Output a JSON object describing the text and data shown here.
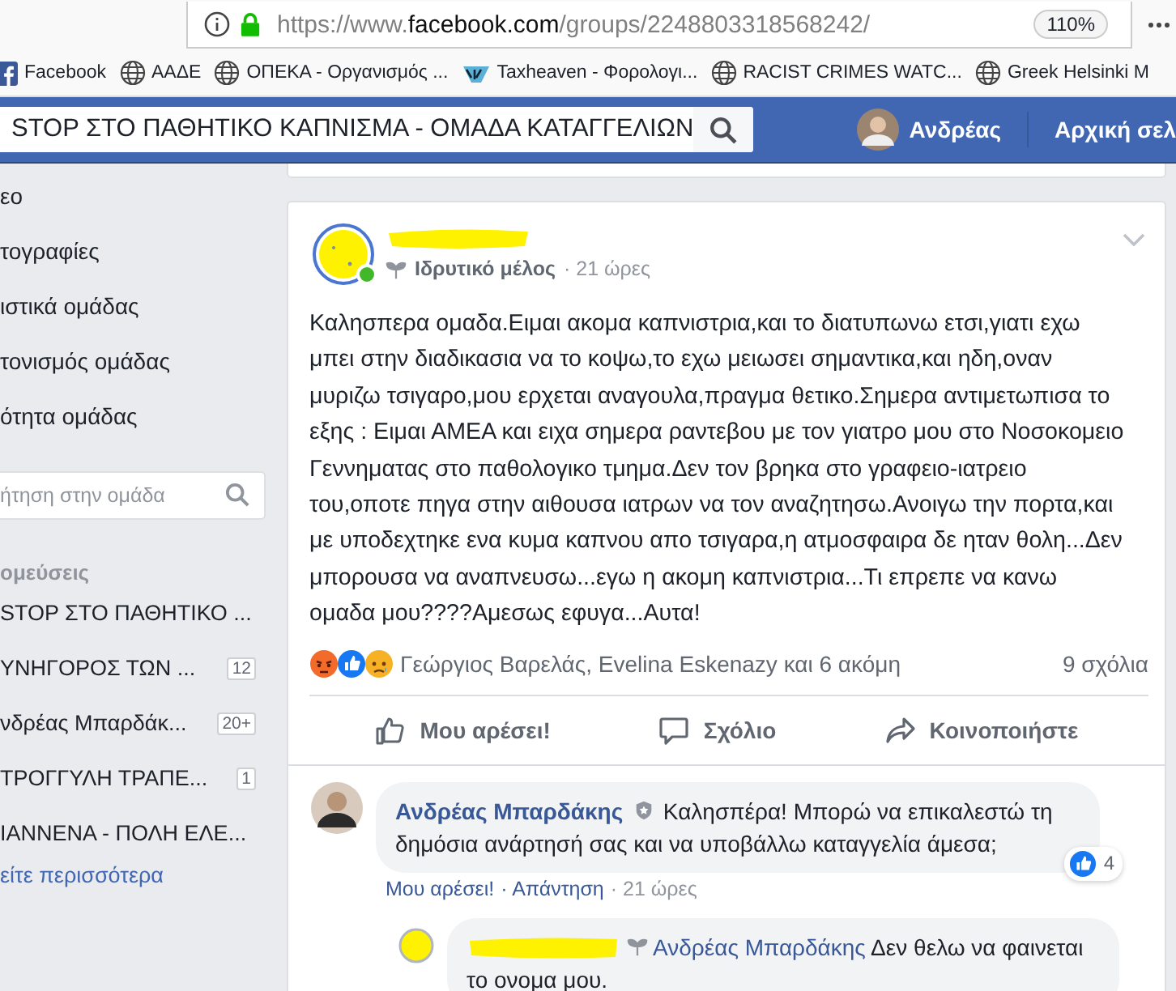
{
  "browser": {
    "url_host": "https://www.",
    "url_domain": "facebook.com",
    "url_path": "/groups/2248803318568242/",
    "zoom": "110%"
  },
  "bookmarks": [
    {
      "kind": "facebook",
      "label": "Facebook"
    },
    {
      "kind": "globe",
      "label": "ΑΑΔΕ"
    },
    {
      "kind": "globe",
      "label": "ΟΠΕΚΑ - Οργανισμός ..."
    },
    {
      "kind": "tax",
      "label": "Taxheaven - Φορολογι..."
    },
    {
      "kind": "globe",
      "label": "RACIST CRIMES WATC..."
    },
    {
      "kind": "globe",
      "label": "Greek Helsinki M"
    }
  ],
  "topbar": {
    "search_value": "STOP ΣΤΟ ΠΑΘΗΤΙΚΟ ΚΑΠΝΙΣΜΑ - ΟΜΑΔΑ ΚΑΤΑΓΓΕΛΙΩΝ",
    "user": "Ανδρέας",
    "home": "Αρχική σελ"
  },
  "sidebar": {
    "items": [
      {
        "label": "εο",
        "selected": false
      },
      {
        "label": "τογραφίες",
        "selected": false
      },
      {
        "label": "ιστικά ομάδας",
        "selected": false
      },
      {
        "label": "τονισμός ομάδας",
        "selected": false
      },
      {
        "label": "ότητα ομάδας",
        "selected": false
      }
    ],
    "search": {
      "placeholder": "ήτηση στην ομάδα"
    },
    "section": "ομεύσεις",
    "groups": [
      {
        "label": "STOP ΣΤΟ ΠΑΘΗΤΙΚΟ ..."
      },
      {
        "label": "ΥΝΗΓΟΡΟΣ ΤΩΝ ...",
        "badge": "12"
      },
      {
        "label": "νδρέας Μπαρδάκ...",
        "badge": "20+"
      },
      {
        "label": "ΤΡΟΓΓΥΛΗ ΤΡΑΠΕ...",
        "badge": "1"
      },
      {
        "label": "ΙΑΝΝΕΝΑ - ΠΟΛΗ ΕΛΕ..."
      }
    ],
    "see_more": "είτε περισσότερα"
  },
  "post": {
    "author_online": true,
    "role": "Ιδρυτικό μέλος",
    "time": "· 21 ώρες",
    "text": "Καλησπερα ομαδα.Ειμαι ακομα καπνιστρια,και το διατυπωνω ετσι,γιατι εχω μπει στην διαδικασια να το κοψω,το εχω μειωσει σημαντικα,και ηδη,οναν μυριζω τσιγαρο,μου ερχεται αναγουλα,πραγμα θετικο.Σημερα αντιμετωπισα το εξης : Ειμαι ΑΜΕΑ και ειχα σημερα ραντεβου με τον γιατρο μου στο Νοσοκομειο Γεννηματας στο παθολογικο τμημα.Δεν τον βρηκα στο γραφειο-ιατρειο του,οποτε πηγα στην αιθουσα ιατρων να τον αναζητησω.Ανοιγω την πορτα,και με υποδεχτηκε ενα κυμα καπνου απο τσιγαρα,η ατμοσφαιρα δε ηταν θολη...Δεν μπορουσα να αναπνευσω...εγω η ακομη καπνιστρια...Τι επρεπε να κανω ομαδα μου????Αμεσως εφυγα...Αυτα!",
    "reactors": "Γεώργιος Βαρελάς, Evelina Eskenazy και 6 ακόμη",
    "comments_count": "9 σχόλια",
    "actions": [
      {
        "kind": "like",
        "label": "Μου αρέσει!"
      },
      {
        "kind": "comment",
        "label": "Σχόλιο"
      },
      {
        "kind": "share",
        "label": "Κοινοποιήστε"
      }
    ]
  },
  "comments": [
    {
      "kind": "admin",
      "author": "Ανδρέας Μπαρδάκης",
      "text": "Καλησπέρα! Μπορώ να επικαλεστώ τη δημόσια ανάρτησή σας και να υποβάλλω καταγγελία άμεσα;",
      "actions": [
        "Μου αρέσει!",
        "· Απάντηση",
        "· 21 ώρες"
      ],
      "likes": "4"
    },
    {
      "kind": "reply",
      "mention": "Ανδρέας Μπαρδάκης",
      "text": "Δεν θελω να φαινεται το ονομα μου."
    }
  ]
}
